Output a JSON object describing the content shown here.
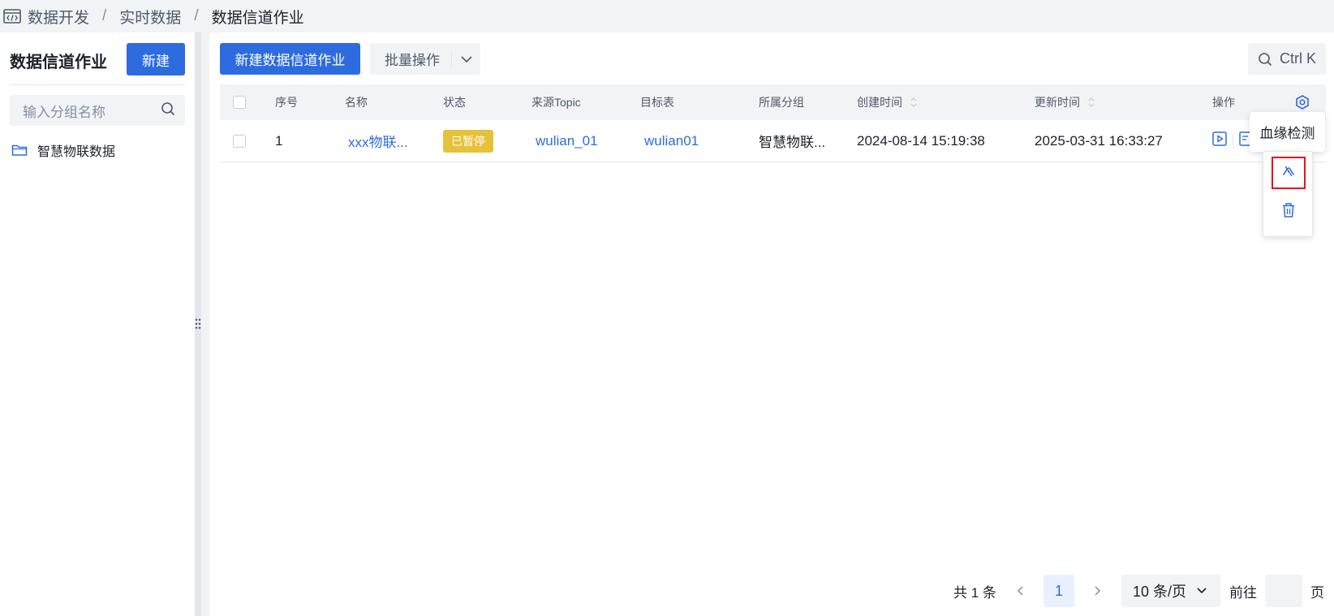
{
  "breadcrumb": {
    "items": [
      "数据开发",
      "实时数据",
      "数据信道作业"
    ],
    "separator": "/"
  },
  "sidebar": {
    "title": "数据信道作业",
    "new_button": "新建",
    "search_placeholder": "输入分组名称",
    "groups": [
      {
        "label": "智慧物联数据"
      }
    ]
  },
  "toolbar": {
    "new_job_button": "新建数据信道作业",
    "batch_button": "批量操作",
    "search_shortcut": "Ctrl K"
  },
  "table": {
    "columns": {
      "index": "序号",
      "name": "名称",
      "status": "状态",
      "source_topic": "来源Topic",
      "target_table": "目标表",
      "group": "所属分组",
      "created": "创建时间",
      "updated": "更新时间",
      "actions": "操作"
    },
    "rows": [
      {
        "index": "1",
        "name": "xxx物联...",
        "status": "已暂停",
        "source_topic": "wulian_01",
        "target_table": "wulian01",
        "group": "智慧物联...",
        "created": "2024-08-14 15:19:38",
        "updated": "2025-03-31 16:33:27"
      }
    ]
  },
  "tooltip": {
    "text": "血缘检测"
  },
  "pagination": {
    "total": "共 1 条",
    "current_page": "1",
    "page_size": "10 条/页",
    "goto_label": "前往",
    "page_suffix": "页"
  },
  "colors": {
    "primary": "#2d6cdf",
    "status_paused": "#e6c13a",
    "highlight_border": "#e6141e"
  },
  "icons": {
    "breadcrumb": "code-window-icon",
    "search": "search-icon",
    "folder": "folder-icon",
    "caret": "chevron-down-icon",
    "settings": "settings-icon",
    "run": "play-icon",
    "edit": "edit-icon",
    "lineage": "lineage-icon",
    "delete": "trash-icon"
  }
}
